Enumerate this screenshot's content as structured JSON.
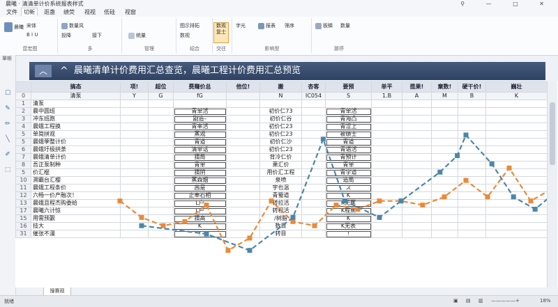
{
  "window": {
    "title": "晨曦 · 清清单计价系统报表样式",
    "controls": "⚲ — □ ✕"
  },
  "tabs": [
    "文件",
    "切新",
    "逛盏",
    "绩荧",
    "视视",
    "低硅",
    "视窗"
  ],
  "ribbon": {
    "group1": {
      "big": "晨曦",
      "b1": "宋体",
      "b2": "B I U",
      "label": "昆宏图"
    },
    "group2": {
      "b1": "数量风",
      "b2": "投降",
      "b3": "接下",
      "label": "多"
    },
    "group3": {
      "b1": "统量",
      "label": "管理"
    },
    "group4": {
      "b1": "图示排拓",
      "b2": "数视",
      "label": "绍合"
    },
    "group5": {
      "b1": "搭座座",
      "b2": "较观",
      "label": "秩键"
    },
    "group6": {
      "big": "数观 复士",
      "label": "交往"
    },
    "group7": {
      "b1": "字光",
      "b2": "报表",
      "b3": "筛序",
      "label": "影响型"
    },
    "group8": {
      "b1": "板鳞",
      "b2": "数量",
      "label": "那停"
    }
  },
  "left_strip": {
    "label": "單帳"
  },
  "banner": {
    "title": "晨曦清单计价费用汇总查览，晨曦工程计价费用汇总预览"
  },
  "table": {
    "headers": [
      "",
      "搞态",
      "项!",
      "超位",
      "费赚价总",
      "他位!",
      "搬",
      "杏客",
      "要预",
      "单平",
      "揽果!",
      "棄数!",
      "硬干价!",
      "巍壮"
    ],
    "subheader": [
      "0",
      "清泵",
      "Y",
      "G",
      "fG",
      "",
      "N",
      "IC054",
      "S",
      "1.B",
      "A",
      "M",
      "B",
      "K",
      "-",
      "2"
    ],
    "rows": [
      {
        "n": "1",
        "name": "清泵",
        "c1": "",
        "c2": "",
        "f": "",
        "e": "",
        "g": "",
        "h": "",
        "v": ""
      },
      {
        "n": "2",
        "name": "晨中圆班",
        "f": "青单活",
        "g": "初价仁73",
        "v": "青单活"
      },
      {
        "n": "3",
        "name": "冲东班跑",
        "f": "副造–",
        "g": "初价仁谷",
        "v": "青海凸"
      },
      {
        "n": "4",
        "name": "晨蛾工程换",
        "f": "青率活",
        "g": "初价仁23",
        "v": "青涩上"
      },
      {
        "n": "5",
        "name": "单简拼观",
        "f": "蒸观",
        "g": "初价仁23",
        "v": "被绩士"
      },
      {
        "n": "5",
        "name": "晨蛾荸整计价",
        "f": "青道",
        "g": "初价仁沙",
        "v": "青道"
      },
      {
        "n": "6",
        "name": "晨蛾圩极拱荼",
        "f": "清单话",
        "g": "初价仁23",
        "v": "青语活"
      },
      {
        "n": "7",
        "name": "晨蛾清单计价",
        "f": "猜局",
        "g": "背冷仁价",
        "v": "青预计"
      },
      {
        "n": "8",
        "name": "吾正泵制种",
        "f": "青单",
        "g": "萧汇价",
        "v": "青单"
      },
      {
        "n": "5",
        "name": "价汇棍",
        "f": "猜阴",
        "g": "用价汇工程",
        "v": "青学道"
      },
      {
        "n": "10",
        "name": "溯霸台汇樱",
        "f": "蒸森烟",
        "g": "泉喷",
        "v": "造局"
      },
      {
        "n": "11",
        "name": "晨蛾工程条价",
        "f": "茜是",
        "g": "宇也温",
        "v": "ス"
      },
      {
        "n": "12",
        "name": "六畅一价产融次！",
        "f": "止奉石相",
        "g": "青蜀道",
        "v": "K"
      },
      {
        "n": "13",
        "name": "晨蛾且程杰购委给",
        "f": "L户",
        "g": "转拉活",
        "v": "K无蕉"
      },
      {
        "n": "17",
        "name": "晨曦六计惊",
        "f": "L户",
        "g": "转程活",
        "v": "K程蕉"
      },
      {
        "n": "15",
        "name": "用需预觐",
        "f": "猜高",
        "g": "/树脂",
        "v": "K"
      },
      {
        "n": "16",
        "name": "技大",
        "f": "K",
        "g": "数目",
        "v": "K无表"
      },
      {
        "n": "31",
        "name": "催张不漫",
        "f": "!",
        "g": "转目",
        "v": "!"
      }
    ]
  },
  "chart_data": {
    "type": "line",
    "series": [
      {
        "name": "",
        "color": "#e88a3a",
        "points": [
          [
            0.0,
            0.58
          ],
          [
            0.05,
            0.66
          ],
          [
            0.1,
            0.7
          ],
          [
            0.15,
            0.68
          ],
          [
            0.2,
            0.6
          ],
          [
            0.25,
            0.82
          ],
          [
            0.3,
            0.76
          ],
          [
            0.35,
            0.58
          ],
          [
            0.4,
            0.68
          ],
          [
            0.45,
            0.7
          ],
          [
            0.5,
            0.6
          ],
          [
            0.55,
            0.62
          ],
          [
            0.6,
            0.58
          ],
          [
            0.65,
            0.58
          ],
          [
            0.7,
            0.6
          ],
          [
            0.75,
            0.56
          ],
          [
            0.8,
            0.48
          ],
          [
            0.85,
            0.56
          ],
          [
            0.9,
            0.42
          ],
          [
            0.95,
            0.58
          ],
          [
            1.0,
            0.52
          ]
        ]
      },
      {
        "name": "",
        "color": "#4b86a8",
        "points": [
          [
            0.05,
            0.7
          ],
          [
            0.2,
            0.74
          ],
          [
            0.3,
            0.82
          ],
          [
            0.4,
            0.66
          ],
          [
            0.47,
            0.28
          ],
          [
            0.52,
            0.58
          ],
          [
            0.6,
            0.66
          ],
          [
            0.65,
            0.58
          ],
          [
            0.74,
            0.44
          ],
          [
            0.78,
            0.36
          ],
          [
            0.8,
            0.26
          ],
          [
            0.86,
            0.4
          ],
          [
            0.91,
            0.56
          ],
          [
            0.96,
            0.62
          ],
          [
            1.0,
            0.55
          ]
        ]
      }
    ]
  },
  "sheet_tab": "搜赛观",
  "status": {
    "left": "就绪",
    "zoom": "18%"
  }
}
